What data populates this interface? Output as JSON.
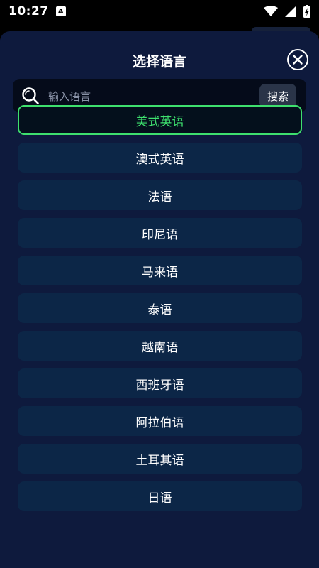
{
  "status_bar": {
    "time": "10:27",
    "notification_glyph": "A"
  },
  "sheet": {
    "title": "选择语言"
  },
  "search": {
    "placeholder": "输入语言",
    "button_label": "搜索"
  },
  "languages": [
    {
      "label": "美式英语",
      "selected": true
    },
    {
      "label": "澳式英语",
      "selected": false
    },
    {
      "label": "法语",
      "selected": false
    },
    {
      "label": "印尼语",
      "selected": false
    },
    {
      "label": "马来语",
      "selected": false
    },
    {
      "label": "泰语",
      "selected": false
    },
    {
      "label": "越南语",
      "selected": false
    },
    {
      "label": "西班牙语",
      "selected": false
    },
    {
      "label": "阿拉伯语",
      "selected": false
    },
    {
      "label": "土耳其语",
      "selected": false
    },
    {
      "label": "日语",
      "selected": false
    }
  ],
  "colors": {
    "sheet_bg": "#0e1a3d",
    "item_bg": "#0c2647",
    "selected_accent": "#3ee06e"
  }
}
